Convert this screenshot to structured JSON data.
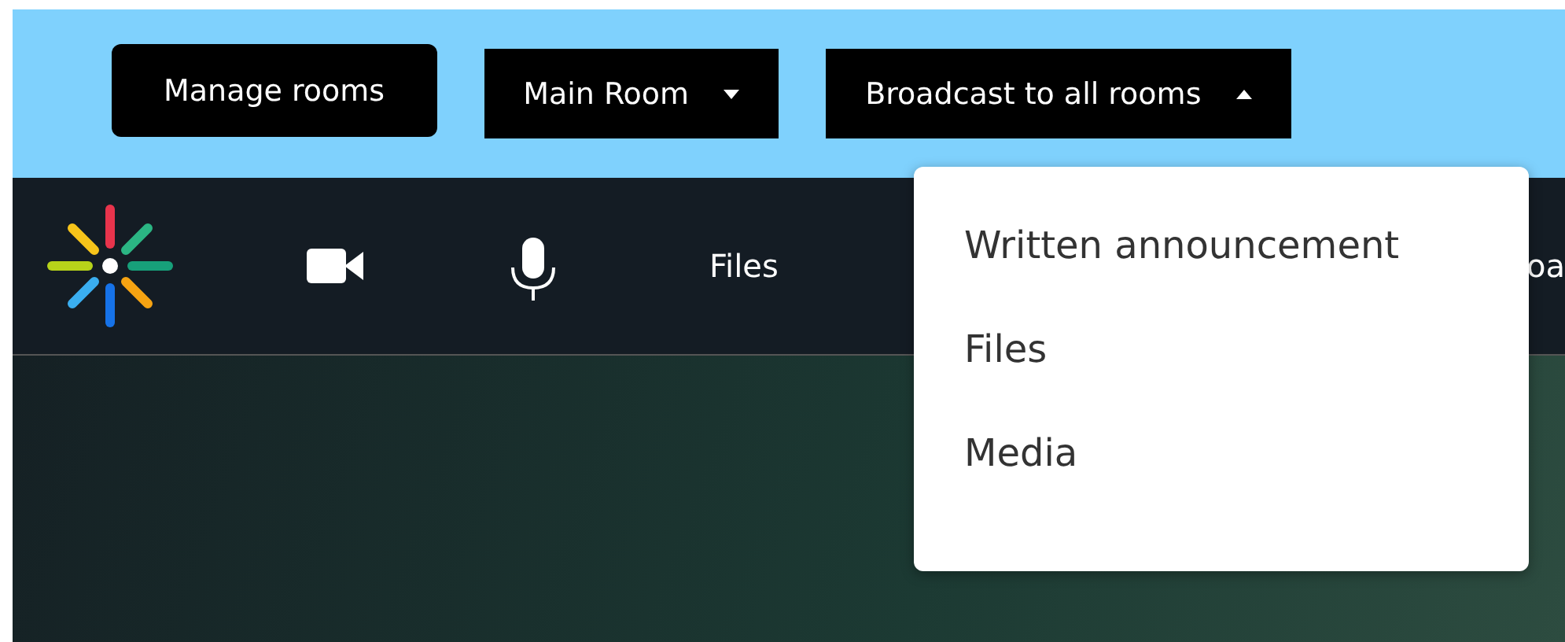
{
  "top_bar": {
    "buttons": [
      {
        "label": "Manage rooms",
        "kind": "button"
      },
      {
        "label": "Main Room",
        "kind": "dropdown",
        "expanded": false
      },
      {
        "label": "Broadcast to all rooms",
        "kind": "dropdown",
        "expanded": true
      }
    ]
  },
  "toolbar": {
    "files_label": "Files",
    "cut_label": "oa"
  },
  "menu": {
    "items": [
      {
        "label": "Written announcement"
      },
      {
        "label": "Files"
      },
      {
        "label": "Media"
      }
    ]
  }
}
